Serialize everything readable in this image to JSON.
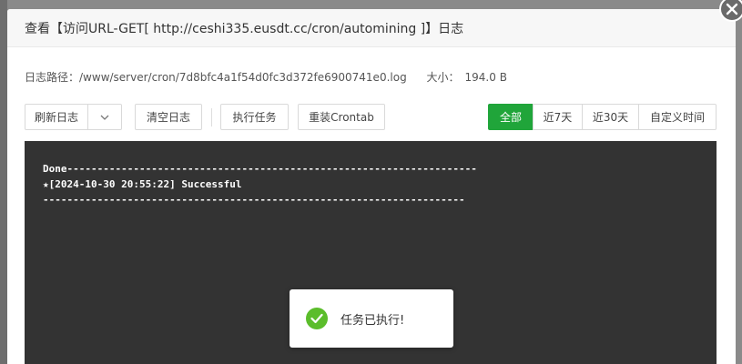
{
  "dialog": {
    "title": "查看【访问URL-GET[ http://ceshi335.eusdt.cc/cron/automining ]】日志"
  },
  "path": {
    "label": "日志路径：",
    "value": "/www/server/cron/7d8bfc4a1f54d0fc3d372fe6900741e0.log",
    "size_label": "大小：",
    "size_value": "194.0 B"
  },
  "toolbar": {
    "refresh_label": "刷新日志",
    "clear_label": "清空日志",
    "run_label": "执行任务",
    "reinstall_label": "重装Crontab"
  },
  "range": {
    "options": [
      "全部",
      "近7天",
      "近30天",
      "自定义时间"
    ],
    "selected": "全部"
  },
  "log": {
    "lines": [
      "Done--------------------------------------------------------------------",
      "★[2024-10-30 20:55:22] Successful",
      "----------------------------------------------------------------------"
    ]
  },
  "toast": {
    "message": "任务已执行!"
  },
  "colors": {
    "accent": "#20a53a",
    "success_icon": "#5bbd2b",
    "log_background": "#333333"
  }
}
